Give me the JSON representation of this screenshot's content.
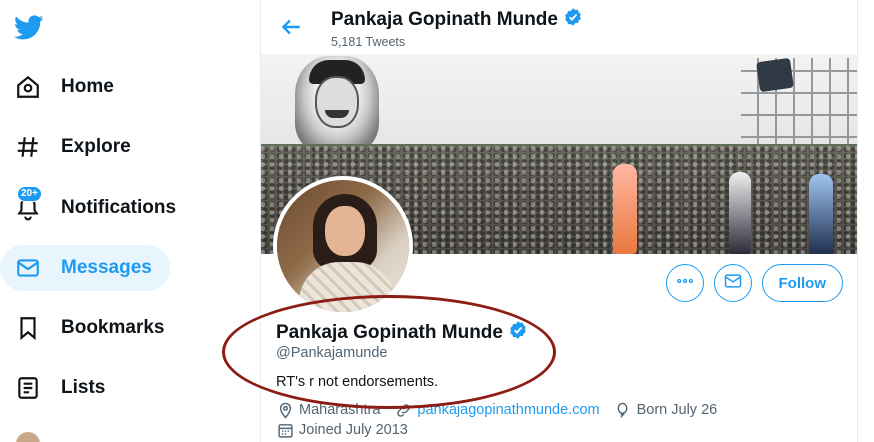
{
  "nav": {
    "items": [
      {
        "label": "Home",
        "icon": "home-icon"
      },
      {
        "label": "Explore",
        "icon": "hashtag-icon"
      },
      {
        "label": "Notifications",
        "icon": "bell-icon",
        "badge": "20+"
      },
      {
        "label": "Messages",
        "icon": "mail-icon",
        "active": true
      },
      {
        "label": "Bookmarks",
        "icon": "bookmark-icon"
      },
      {
        "label": "Lists",
        "icon": "list-icon"
      }
    ]
  },
  "header": {
    "name": "Pankaja Gopinath Munde",
    "tweet_count": "5,181 Tweets"
  },
  "profile": {
    "name": "Pankaja Gopinath Munde",
    "handle": "@Pankajamunde",
    "bio": "RT's r not endorsements.",
    "location": "Maharashtra",
    "website": "pankajagopinathmunde.com",
    "birthday": "Born July 26",
    "joined": "Joined July 2013"
  },
  "actions": {
    "follow_label": "Follow"
  },
  "colors": {
    "accent": "#1d9bf0",
    "annotation": "#8c1c14"
  }
}
